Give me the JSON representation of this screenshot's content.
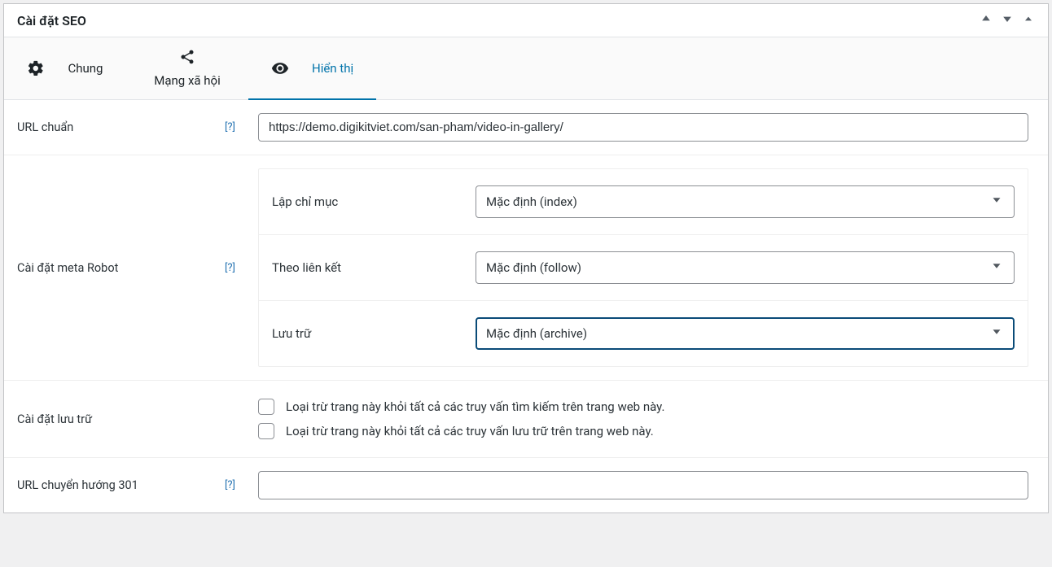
{
  "panel": {
    "title": "Cài đặt SEO"
  },
  "tabs": {
    "general": "Chung",
    "social": "Mạng xã hội",
    "display": "Hiển thị"
  },
  "rows": {
    "canonical": {
      "label": "URL chuẩn",
      "help": "[?]",
      "value": "https://demo.digikitviet.com/san-pham/video-in-gallery/"
    },
    "robots": {
      "label": "Cài đặt meta Robot",
      "help": "[?]",
      "index": {
        "label": "Lập chỉ mục",
        "value": "Mặc định (index)"
      },
      "follow": {
        "label": "Theo liên kết",
        "value": "Mặc định (follow)"
      },
      "archive": {
        "label": "Lưu trữ",
        "value": "Mặc định (archive)"
      }
    },
    "archive_settings": {
      "label": "Cài đặt lưu trữ",
      "exclude_search": "Loại trừ trang này khỏi tất cả các truy vấn tìm kiếm trên trang web này.",
      "exclude_archive": "Loại trừ trang này khỏi tất cả các truy vấn lưu trữ trên trang web này."
    },
    "redirect": {
      "label": "URL chuyển hướng 301",
      "help": "[?]",
      "value": ""
    }
  }
}
